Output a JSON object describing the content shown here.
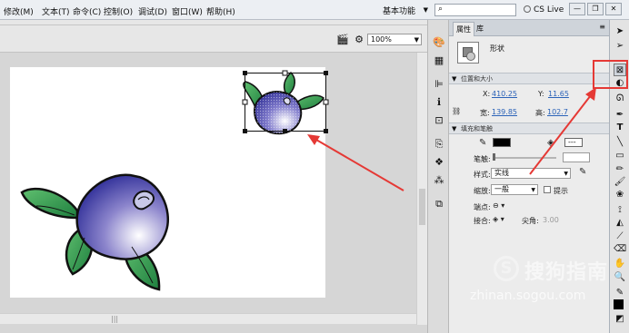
{
  "menubar": {
    "items": [
      "修改(M)",
      "文本(T)",
      "命令(C)",
      "控制(O)",
      "调试(D)",
      "窗口(W)",
      "帮助(H)"
    ],
    "workspace_label": "基本功能",
    "search_placeholder": "",
    "cslive_label": "CS Live",
    "window_controls": [
      "minimize",
      "restore",
      "close"
    ]
  },
  "editbar": {
    "zoom_value": "100%"
  },
  "properties_panel": {
    "tabs": [
      "属性",
      "库"
    ],
    "object_type": "形状",
    "sections": {
      "position_size": "位置和大小",
      "fill_stroke": "填充和笔触"
    },
    "x_label": "X:",
    "x_value": "410.25",
    "y_label": "Y:",
    "y_value": "11.65",
    "width_label": "宽:",
    "width_value": "139.85",
    "height_label": "高:",
    "height_value": "102.7",
    "stroke_label": "笔触:",
    "style_label": "样式:",
    "style_value": "实线",
    "scale_label": "缩放:",
    "scale_value": "一般",
    "hint_label": "提示",
    "cap_label": "端点:",
    "join_label": "接合:",
    "miter_label": "尖角:",
    "miter_value": "3.00",
    "stroke_color": "#000000",
    "fill_color": "#000000"
  },
  "tools": [
    "selection-tool",
    "subselection-tool",
    "free-transform-tool",
    "gradient-transform-tool",
    "lasso-tool",
    "pen-tool",
    "text-tool",
    "line-tool",
    "rectangle-tool",
    "pencil-tool",
    "brush-tool",
    "deco-tool",
    "bone-tool",
    "paint-bucket-tool",
    "eyedropper-tool",
    "eraser-tool",
    "hand-tool",
    "zoom-tool",
    "stroke-color",
    "fill-color"
  ],
  "watermark": {
    "logo_char": "S",
    "chinese": "搜狗指南",
    "url": "zhinan.sogou.com"
  },
  "colors": {
    "annotation_red": "#e53935",
    "berry_dark": "#2a2a9a",
    "leaf_green": "#3f9f4f"
  }
}
